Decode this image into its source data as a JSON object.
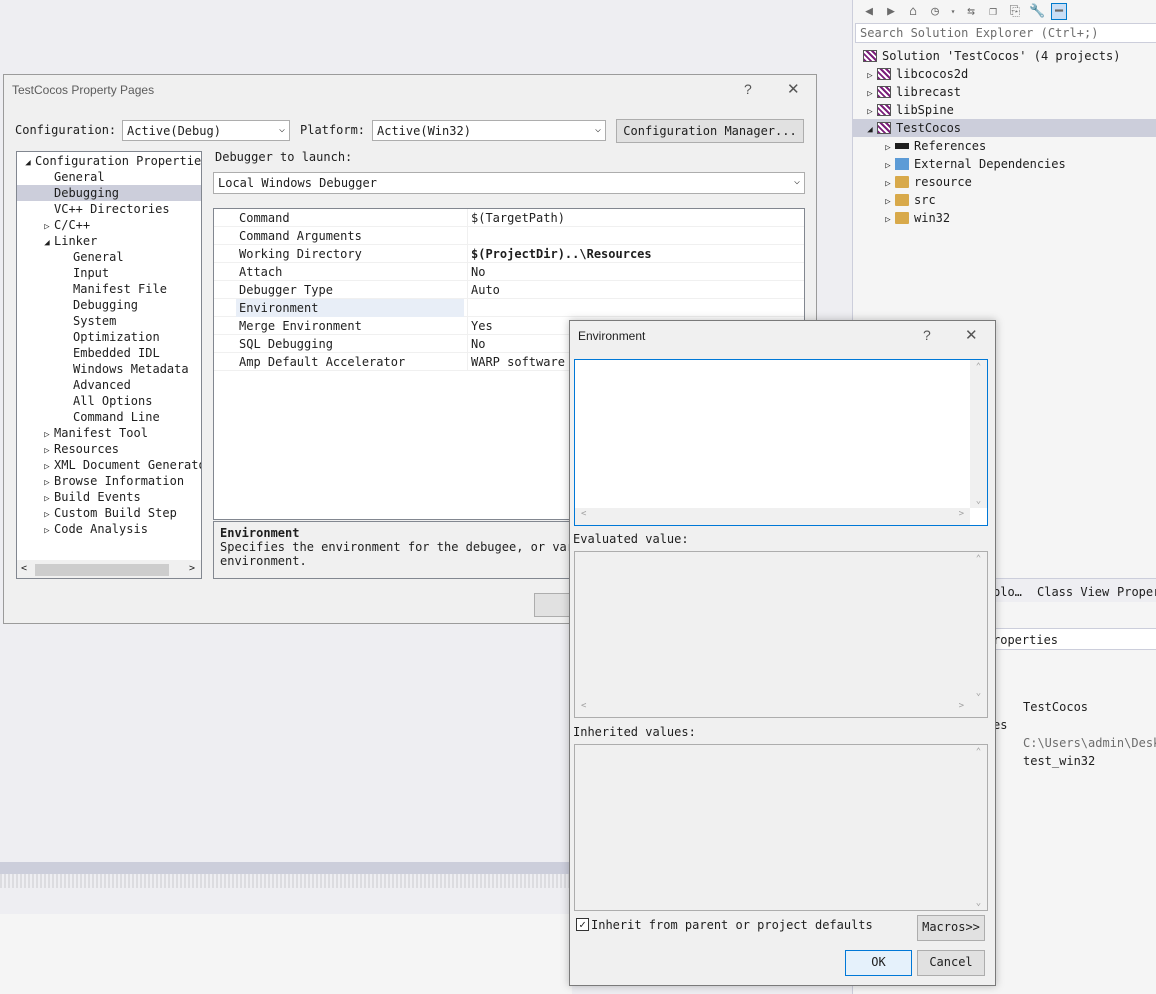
{
  "solution_explorer": {
    "search_placeholder": "Search Solution Explorer (Ctrl+;)",
    "solution": "Solution 'TestCocos' (4 projects)",
    "projects": [
      "libcocos2d",
      "librecast",
      "libSpine",
      "TestCocos"
    ],
    "children": [
      "References",
      "External Dependencies",
      "resource",
      "src",
      "win32"
    ],
    "bottom_tabs": [
      "plo…",
      "Class View",
      "Proper"
    ],
    "properties_header": "roperties",
    "properties_values": [
      "TestCocos",
      "es",
      "C:\\Users\\admin\\Desk",
      "test_win32"
    ],
    "toolbar_icons": [
      "back-icon",
      "forward-icon",
      "home-icon",
      "history-icon",
      "dropdown-icon",
      "sync-icon",
      "collapse-icon",
      "copy-icon",
      "wrench-icon",
      "minus-icon"
    ]
  },
  "property_pages": {
    "title": "TestCocos Property Pages",
    "help": "?",
    "close": "✕",
    "configuration_label": "Configuration:",
    "configuration_value": "Active(Debug)",
    "platform_label": "Platform:",
    "platform_value": "Active(Win32)",
    "config_manager": "Configuration Manager...",
    "tree": [
      {
        "label": "Configuration Properties",
        "indent": 0,
        "tri": "◢"
      },
      {
        "label": "General",
        "indent": 1,
        "tri": ""
      },
      {
        "label": "Debugging",
        "indent": 1,
        "tri": "",
        "selected": true
      },
      {
        "label": "VC++ Directories",
        "indent": 1,
        "tri": ""
      },
      {
        "label": "C/C++",
        "indent": 1,
        "tri": "▷"
      },
      {
        "label": "Linker",
        "indent": 1,
        "tri": "◢"
      },
      {
        "label": "General",
        "indent": 2,
        "tri": ""
      },
      {
        "label": "Input",
        "indent": 2,
        "tri": ""
      },
      {
        "label": "Manifest File",
        "indent": 2,
        "tri": ""
      },
      {
        "label": "Debugging",
        "indent": 2,
        "tri": ""
      },
      {
        "label": "System",
        "indent": 2,
        "tri": ""
      },
      {
        "label": "Optimization",
        "indent": 2,
        "tri": ""
      },
      {
        "label": "Embedded IDL",
        "indent": 2,
        "tri": ""
      },
      {
        "label": "Windows Metadata",
        "indent": 2,
        "tri": ""
      },
      {
        "label": "Advanced",
        "indent": 2,
        "tri": ""
      },
      {
        "label": "All Options",
        "indent": 2,
        "tri": ""
      },
      {
        "label": "Command Line",
        "indent": 2,
        "tri": ""
      },
      {
        "label": "Manifest Tool",
        "indent": 1,
        "tri": "▷"
      },
      {
        "label": "Resources",
        "indent": 1,
        "tri": "▷"
      },
      {
        "label": "XML Document Generator",
        "indent": 1,
        "tri": "▷"
      },
      {
        "label": "Browse Information",
        "indent": 1,
        "tri": "▷"
      },
      {
        "label": "Build Events",
        "indent": 1,
        "tri": "▷"
      },
      {
        "label": "Custom Build Step",
        "indent": 1,
        "tri": "▷"
      },
      {
        "label": "Code Analysis",
        "indent": 1,
        "tri": "▷"
      }
    ],
    "debugger_label": "Debugger to launch:",
    "debugger_value": "Local Windows Debugger",
    "grid": [
      {
        "name": "Command",
        "value": "$(TargetPath)"
      },
      {
        "name": "Command Arguments",
        "value": ""
      },
      {
        "name": "Working Directory",
        "value": "$(ProjectDir)..\\Resources",
        "bold": true
      },
      {
        "name": "Attach",
        "value": "No"
      },
      {
        "name": "Debugger Type",
        "value": "Auto"
      },
      {
        "name": "Environment",
        "value": "",
        "selected": true
      },
      {
        "name": "Merge Environment",
        "value": "Yes"
      },
      {
        "name": "SQL Debugging",
        "value": "No"
      },
      {
        "name": "Amp Default Accelerator",
        "value": "WARP software"
      }
    ],
    "desc_title": "Environment",
    "desc_text": "Specifies the environment for the debugee, or vari",
    "desc_text2": "environment."
  },
  "environment_dialog": {
    "title": "Environment",
    "help": "?",
    "close": "✕",
    "evaluated_label": "Evaluated value:",
    "inherited_label": "Inherited values:",
    "inherit_checkbox": "Inherit from parent or project defaults",
    "inherit_checked": true,
    "macros": "Macros>>",
    "ok": "OK",
    "cancel": "Cancel"
  }
}
